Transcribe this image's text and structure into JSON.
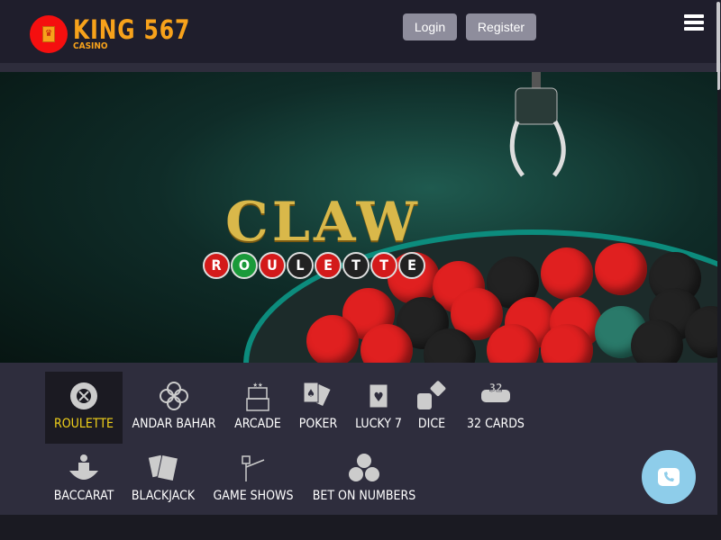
{
  "header": {
    "logo_main": "KING 567",
    "logo_sub": "CASINO",
    "login": "Login",
    "register": "Register"
  },
  "banner": {
    "title": "CLAW",
    "subtitle_letters": [
      "R",
      "O",
      "U",
      "L",
      "E",
      "T",
      "T",
      "E"
    ]
  },
  "categories": [
    {
      "label": "ROULETTE",
      "icon": "roulette-icon",
      "active": true
    },
    {
      "label": "ANDAR BAHAR",
      "icon": "card-suits-icon"
    },
    {
      "label": "ARCADE",
      "icon": "arcade-icon"
    },
    {
      "label": "POKER",
      "icon": "poker-cards-icon"
    },
    {
      "label": "LUCKY 7",
      "icon": "lucky7-cards-icon"
    },
    {
      "label": "DICE",
      "icon": "dice-icon"
    },
    {
      "label": "32 CARDS",
      "icon": "32-cards-icon"
    },
    {
      "label": "BACCARAT",
      "icon": "baccarat-dealer-icon"
    },
    {
      "label": "BLACKJACK",
      "icon": "blackjack-cards-icon"
    },
    {
      "label": "GAME SHOWS",
      "icon": "game-show-host-icon"
    },
    {
      "label": "BET ON NUMBERS",
      "icon": "number-balls-icon"
    }
  ],
  "colors": {
    "header_bg": "#1f1e2c",
    "accent": "#f7a21b",
    "active_label": "#f2d21a",
    "panel_bg": "#2e2d3d",
    "phone_button": "#8ecdea"
  }
}
